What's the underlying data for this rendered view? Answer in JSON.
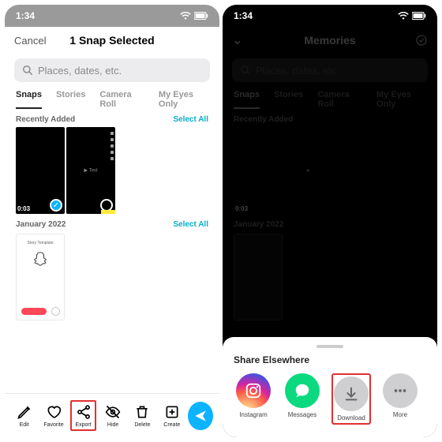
{
  "left": {
    "status_time": "1:34",
    "header": {
      "cancel": "Cancel",
      "title": "1 Snap Selected"
    },
    "search_placeholder": "Places, dates, etc.",
    "tabs": [
      "Snaps",
      "Stories",
      "Camera Roll",
      "My Eyes Only"
    ],
    "active_tab": 0,
    "sections": [
      {
        "label": "Recently Added",
        "select_all": "Select All",
        "thumbs": [
          {
            "duration": "0:03",
            "selected": true
          },
          {
            "caption": "▶ Text",
            "selected": false
          }
        ]
      },
      {
        "label": "January 2022",
        "select_all": "Select All",
        "card_label": "Story Template"
      }
    ],
    "toolbar": [
      {
        "id": "edit",
        "label": "Edit"
      },
      {
        "id": "favorite",
        "label": "Favorite"
      },
      {
        "id": "export",
        "label": "Export",
        "highlight": true
      },
      {
        "id": "hide",
        "label": "Hide"
      },
      {
        "id": "delete",
        "label": "Delete"
      },
      {
        "id": "create",
        "label": "Create"
      }
    ]
  },
  "right": {
    "status_time": "1:34",
    "header_title": "Memories",
    "search_placeholder": "Places, dates, etc.",
    "tabs": [
      "Snaps",
      "Stories",
      "Camera Roll",
      "My Eyes Only"
    ],
    "sections": [
      {
        "label": "Recently Added",
        "duration": "0:03"
      },
      {
        "label": "January 2022"
      }
    ],
    "share": {
      "title": "Share Elsewhere",
      "options": [
        {
          "id": "instagram",
          "label": "Instagram"
        },
        {
          "id": "messages",
          "label": "Messages"
        },
        {
          "id": "download",
          "label": "Download",
          "highlight": true
        },
        {
          "id": "more",
          "label": "More"
        }
      ]
    }
  }
}
